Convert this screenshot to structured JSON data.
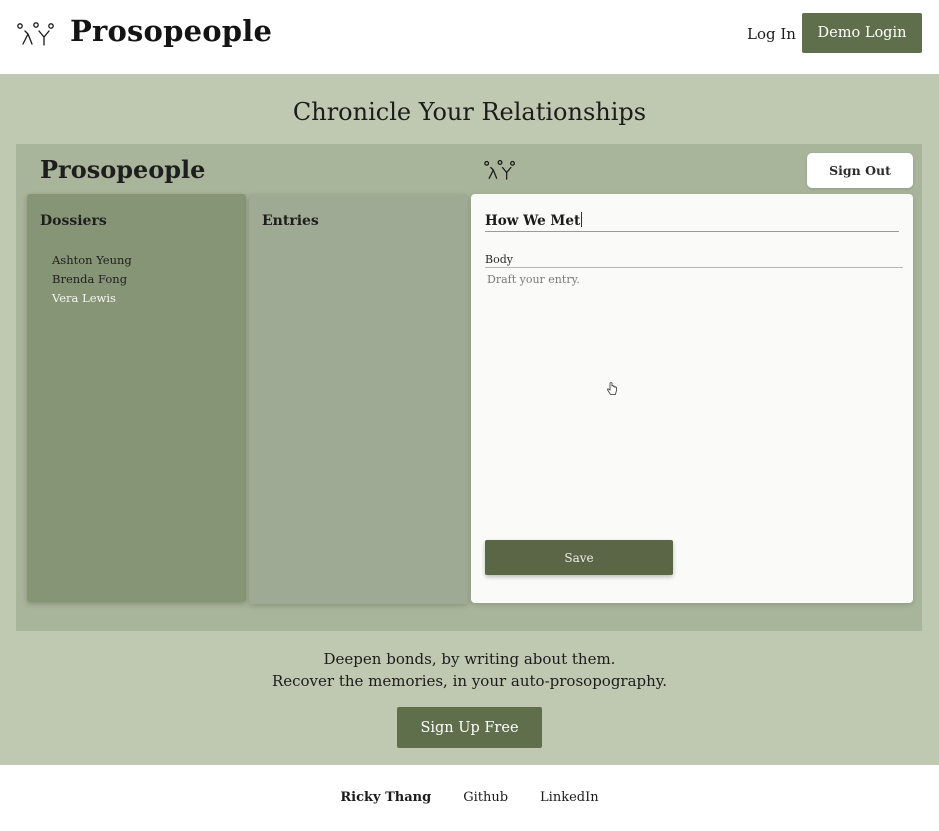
{
  "header": {
    "brand_title": "Prosopeople",
    "logo_icon": "stick-figures-icon",
    "login_label": "Log In",
    "demo_login_label": "Demo Login"
  },
  "hero": {
    "title": "Chronicle Your Relationships",
    "tagline_line1": "Deepen bonds, by writing about them.",
    "tagline_line2": "Recover the memories, in your auto-prosopography.",
    "signup_label": "Sign Up Free"
  },
  "preview": {
    "app_title": "Prosopeople",
    "sign_out_label": "Sign Out",
    "dossiers": {
      "heading": "Dossiers",
      "items": [
        {
          "label": "Ashton Yeung",
          "active": false
        },
        {
          "label": "Brenda Fong",
          "active": false
        },
        {
          "label": "Vera Lewis",
          "active": true
        }
      ]
    },
    "entries": {
      "heading": "Entries"
    },
    "editor": {
      "title_value": "How We Met",
      "body_label": "Body",
      "body_placeholder": "Draft your entry.",
      "save_label": "Save"
    }
  },
  "footer": {
    "author": "Ricky Thang",
    "github_label": "Github",
    "linkedin_label": "LinkedIn"
  },
  "colors": {
    "accent_green": "#5f6f4c",
    "hero_background": "#bfc8b1",
    "dossier_panel": "#879577",
    "entries_panel": "#9eaa93"
  }
}
